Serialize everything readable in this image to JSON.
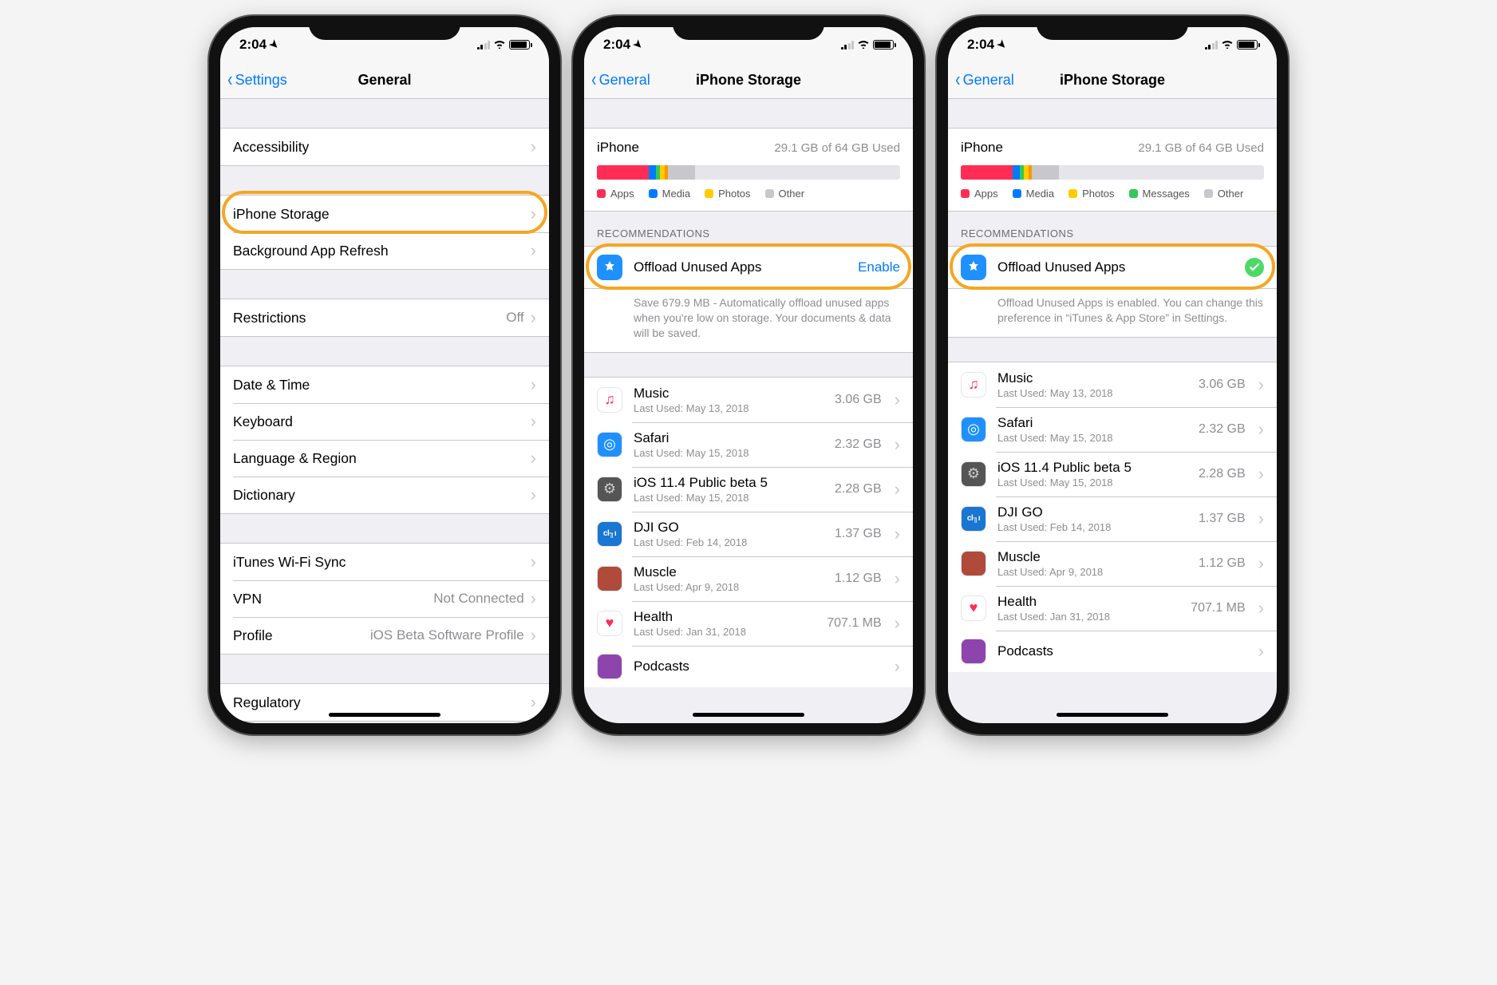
{
  "status": {
    "time": "2:04"
  },
  "screen1": {
    "back": "Settings",
    "title": "General",
    "groups": [
      [
        {
          "label": "Accessibility"
        }
      ],
      [
        {
          "label": "iPhone Storage",
          "highlight": true
        },
        {
          "label": "Background App Refresh"
        }
      ],
      [
        {
          "label": "Restrictions",
          "value": "Off"
        }
      ],
      [
        {
          "label": "Date & Time"
        },
        {
          "label": "Keyboard"
        },
        {
          "label": "Language & Region"
        },
        {
          "label": "Dictionary"
        }
      ],
      [
        {
          "label": "iTunes Wi-Fi Sync"
        },
        {
          "label": "VPN",
          "value": "Not Connected"
        },
        {
          "label": "Profile",
          "value": "iOS Beta Software Profile"
        }
      ],
      [
        {
          "label": "Regulatory"
        }
      ]
    ]
  },
  "storage": {
    "back": "General",
    "title": "iPhone Storage",
    "device": "iPhone",
    "used": "29.1 GB of 64 GB Used",
    "segments": [
      {
        "color": "#ff2d55",
        "pct": 17
      },
      {
        "color": "#007aff",
        "pct": 2.5
      },
      {
        "color": "#34c759",
        "pct": 1.2
      },
      {
        "color": "#ffcc00",
        "pct": 1.8
      },
      {
        "color": "#ff9500",
        "pct": 1
      },
      {
        "color": "#c7c7cc",
        "pct": 9
      }
    ],
    "legend2": [
      {
        "label": "Apps",
        "color": "#ff2d55"
      },
      {
        "label": "Media",
        "color": "#007aff"
      },
      {
        "label": "Photos",
        "color": "#ffcc00"
      },
      {
        "label": "Other",
        "color": "#c7c7cc"
      }
    ],
    "legend3": [
      {
        "label": "Apps",
        "color": "#ff2d55"
      },
      {
        "label": "Media",
        "color": "#007aff"
      },
      {
        "label": "Photos",
        "color": "#ffcc00"
      },
      {
        "label": "Messages",
        "color": "#34c759"
      },
      {
        "label": "Other",
        "color": "#c7c7cc"
      }
    ],
    "recLabel": "RECOMMENDATIONS",
    "rec": {
      "title": "Offload Unused Apps",
      "action": "Enable",
      "desc2": "Save 679.9 MB - Automatically offload unused apps when you're low on storage. Your documents & data will be saved.",
      "desc3": "Offload Unused Apps is enabled. You can change this preference in “iTunes & App Store” in Settings."
    },
    "apps": [
      {
        "name": "Music",
        "sub": "Last Used: May 13, 2018",
        "size": "3.06 GB",
        "bg": "#fff",
        "fg": "#ff2d55",
        "glyph": "♫"
      },
      {
        "name": "Safari",
        "sub": "Last Used: May 15, 2018",
        "size": "2.32 GB",
        "bg": "#1e90ff",
        "fg": "#fff",
        "glyph": "◎"
      },
      {
        "name": "iOS 11.4 Public beta 5",
        "sub": "Last Used: May 15, 2018",
        "size": "2.28 GB",
        "bg": "#555",
        "fg": "#ccc",
        "glyph": "⚙"
      },
      {
        "name": "DJI GO",
        "sub": "Last Used: Feb 14, 2018",
        "size": "1.37 GB",
        "bg": "#1976d2",
        "fg": "#fff",
        "glyph": "dji"
      },
      {
        "name": "Muscle",
        "sub": "Last Used: Apr 9, 2018",
        "size": "1.12 GB",
        "bg": "#b04a3a",
        "fg": "#fff",
        "glyph": ""
      },
      {
        "name": "Health",
        "sub": "Last Used: Jan 31, 2018",
        "size": "707.1 MB",
        "bg": "#fff",
        "fg": "#ff2d55",
        "glyph": "♥"
      },
      {
        "name": "Podcasts",
        "sub": "",
        "size": "",
        "bg": "#8e44ad",
        "fg": "#fff",
        "glyph": ""
      }
    ]
  }
}
